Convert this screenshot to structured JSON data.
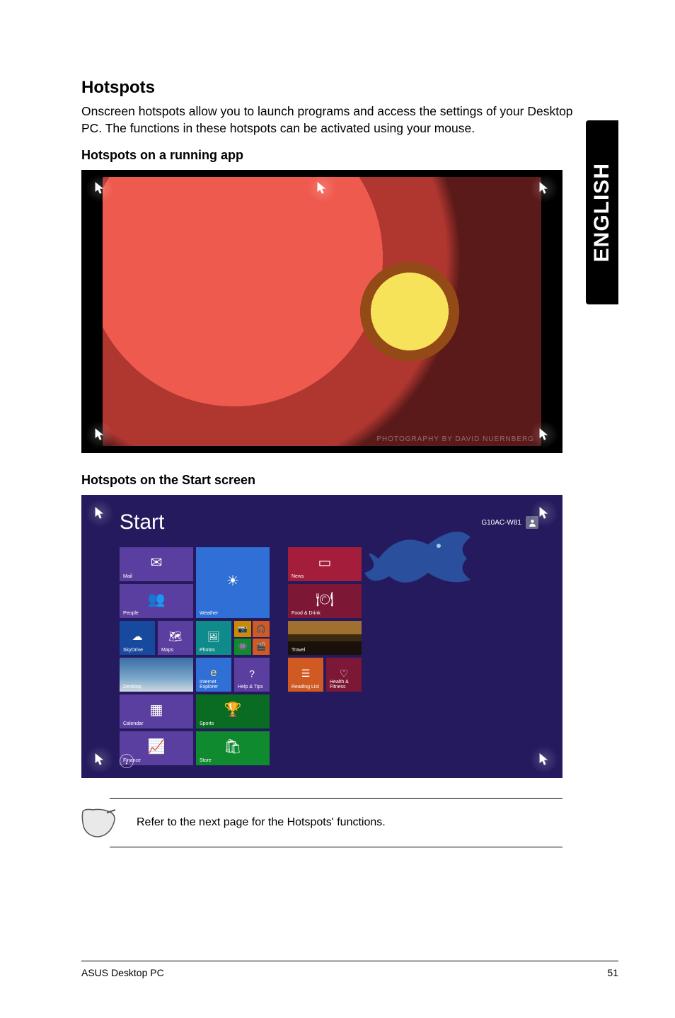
{
  "sideTab": "ENGLISH",
  "title": "Hotspots",
  "intro": "Onscreen hotspots allow you to launch programs and access the settings of your Desktop PC. The functions in these hotspots can be activated using your mouse.",
  "sub1": "Hotspots on a running app",
  "sub2": "Hotspots on the Start screen",
  "startScreen": {
    "label": "Start",
    "user": "G10AC-W81",
    "tiles": {
      "mail": "Mail",
      "people": "People",
      "weather": "Weather",
      "news": "News",
      "food": "Food & Drink",
      "skydrive": "SkyDrive",
      "maps": "Maps",
      "photos": "Photos",
      "travel": "Travel",
      "desktop": "Desktop",
      "ie": "Internet Explorer",
      "help": "Help & Tips",
      "reading": "Reading List",
      "health": "Health & Fitness",
      "calendar": "Calendar",
      "sports": "Sports",
      "finance": "Finance",
      "store": "Store"
    }
  },
  "noteText": "Refer to the next page for the Hotspots' functions.",
  "footer": {
    "left": "ASUS Desktop PC",
    "right": "51"
  }
}
